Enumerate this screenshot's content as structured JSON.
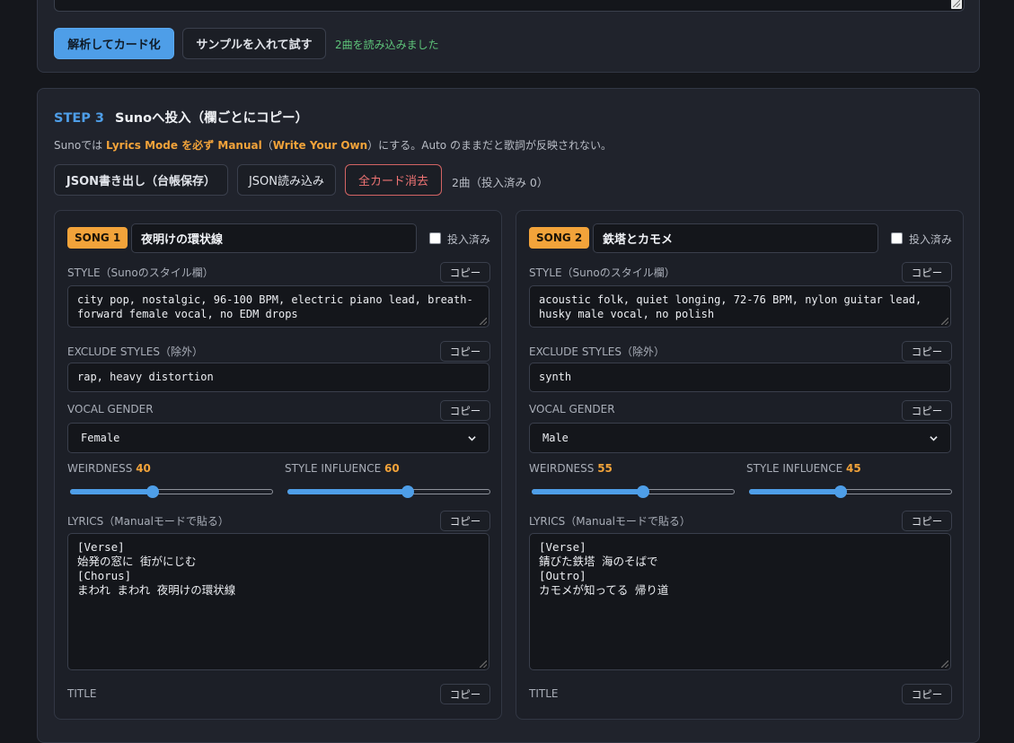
{
  "step2": {
    "parse_button": "解析してカード化",
    "sample_button": "サンプルを入れて試す",
    "status": "2曲を読み込みました"
  },
  "step3": {
    "label": "STEP 3",
    "title": "Sunoへ投入（欄ごとにコピー）",
    "hint_prefix": "Sunoでは ",
    "hint_highlight1": "Lyrics Mode を必ず Manual",
    "hint_mid": "（",
    "hint_highlight2": "Write Your Own",
    "hint_suffix": "）にする。Auto のままだと歌詞が反映されない。",
    "export_button": "JSON書き出し（台帳保存）",
    "import_button": "JSON読み込み",
    "clear_button": "全カード消去",
    "count_text": "2曲（投入済み 0）"
  },
  "labels": {
    "done": "投入済み",
    "style": "STYLE（Sunoのスタイル欄）",
    "exclude": "EXCLUDE STYLES（除外）",
    "vocal_gender": "VOCAL GENDER",
    "weirdness": "WEIRDNESS",
    "style_influence": "STYLE INFLUENCE",
    "lyrics": "LYRICS（Manualモードで貼る）",
    "title": "TITLE",
    "copy": "コピー"
  },
  "songs": [
    {
      "badge": "SONG 1",
      "name": "夜明けの環状線",
      "done": false,
      "style": "city pop, nostalgic, 96-100 BPM, electric piano lead, breath-forward female vocal, no EDM drops",
      "exclude": "rap, heavy distortion",
      "vocal_gender": "Female",
      "weirdness": 40,
      "style_influence": 60,
      "lyrics": "[Verse]\n始発の窓に 街がにじむ\n[Chorus]\nまわれ まわれ 夜明けの環状線"
    },
    {
      "badge": "SONG 2",
      "name": "鉄塔とカモメ",
      "done": false,
      "style": "acoustic folk, quiet longing, 72-76 BPM, nylon guitar lead, husky male vocal, no polish",
      "exclude": "synth",
      "vocal_gender": "Male",
      "weirdness": 55,
      "style_influence": 45,
      "lyrics": "[Verse]\n錆びた鉄塔 海のそばで\n[Outro]\nカモメが知ってる 帰り道"
    }
  ],
  "colors": {
    "accent_blue": "#4e9ee8",
    "accent_orange": "#f2a33a",
    "success_green": "#5ec47a",
    "danger_red": "#ef7474"
  }
}
